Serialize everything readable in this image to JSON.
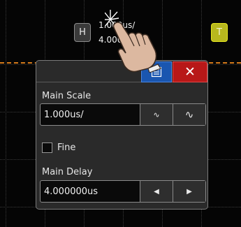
{
  "top": {
    "h_label": "H",
    "t_label": "T",
    "readout_line1": "1.000us/",
    "readout_line2": "4.000"
  },
  "dialog": {
    "menu_icon": "menu-icon",
    "close_symbol": "✕",
    "main_scale": {
      "label": "Main Scale",
      "value": "1.000us/",
      "coarse_icon": "∿",
      "fine_icon": "∿"
    },
    "fine": {
      "label": "Fine",
      "checked": false
    },
    "main_delay": {
      "label": "Main Delay",
      "value": "4.000000us",
      "left_arrow": "◀",
      "right_arrow": "▶"
    }
  },
  "colors": {
    "trace": "#d47a1a",
    "menu_button": "#1a56b0",
    "close_button": "#b81818",
    "t_button": "#b8b81e"
  }
}
